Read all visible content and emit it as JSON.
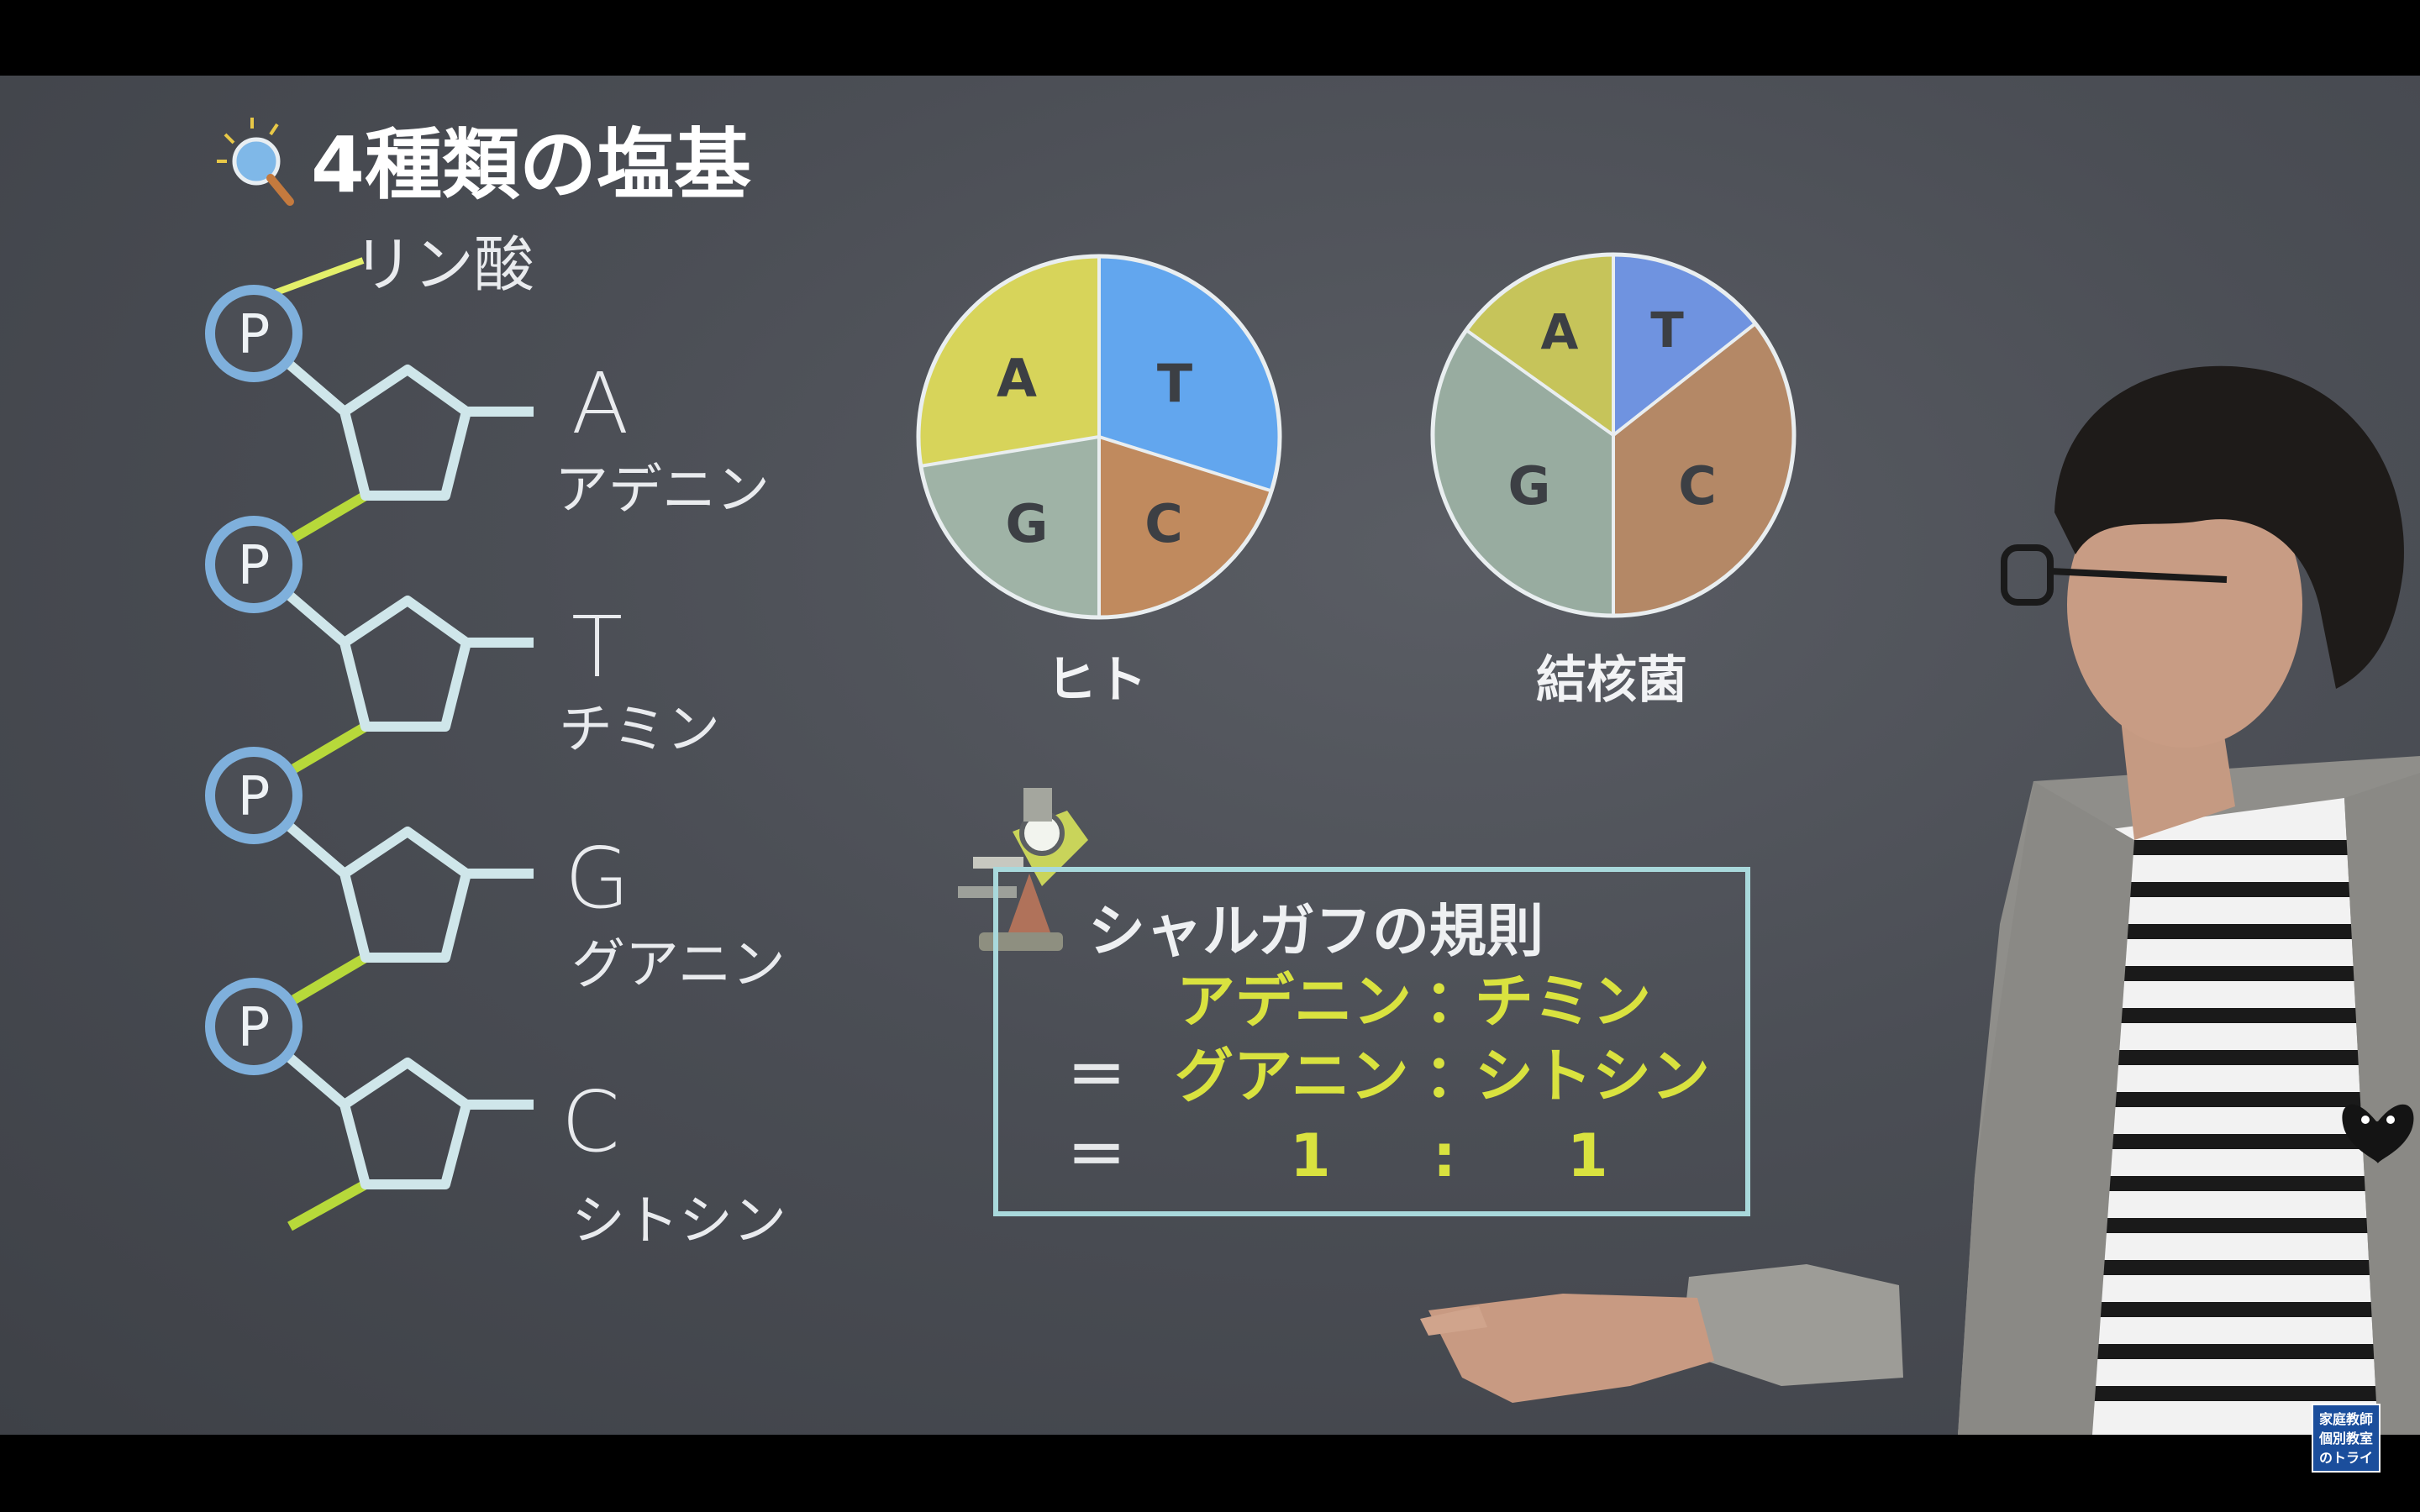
{
  "title": "4種類の塩基",
  "phosphate_note": "リン酸",
  "phosphate_symbol": "P",
  "bases": [
    {
      "letter": "A",
      "name": "アデニン"
    },
    {
      "letter": "T",
      "name": "チミン"
    },
    {
      "letter": "G",
      "name": "グアニン"
    },
    {
      "letter": "C",
      "name": "シトシン"
    }
  ],
  "pies": [
    {
      "caption": "ヒト",
      "slices": [
        {
          "label": "A",
          "color": "#d7d45a"
        },
        {
          "label": "T",
          "color": "#62a6ee"
        },
        {
          "label": "C",
          "color": "#c08a5e"
        },
        {
          "label": "G",
          "color": "#9fb3a6"
        }
      ]
    },
    {
      "caption": "結核菌",
      "slices": [
        {
          "label": "A",
          "color": "#c6c45a"
        },
        {
          "label": "T",
          "color": "#6f93e0"
        },
        {
          "label": "C",
          "color": "#b48866"
        },
        {
          "label": "G",
          "color": "#98aca0"
        }
      ]
    }
  ],
  "rule": {
    "title": "シャルガフの規則",
    "row1_left": "アデニン",
    "row1_colon": "：",
    "row1_right": "チミン",
    "eq": "＝",
    "row2_left": "グアニン",
    "row2_colon": "：",
    "row2_right": "シトシン",
    "row3_left": "1",
    "row3_colon": ":",
    "row3_right": "1"
  },
  "logo": {
    "line1": "家庭教師",
    "line2": "個別教室",
    "line3": "のトライ"
  },
  "colors": {
    "board": "#4b4e55",
    "phosphate": "#7fb0dc",
    "sugar": "#cfe6ea",
    "backbone": "#b7d93a",
    "rule_box": "#a9d9dc"
  }
}
